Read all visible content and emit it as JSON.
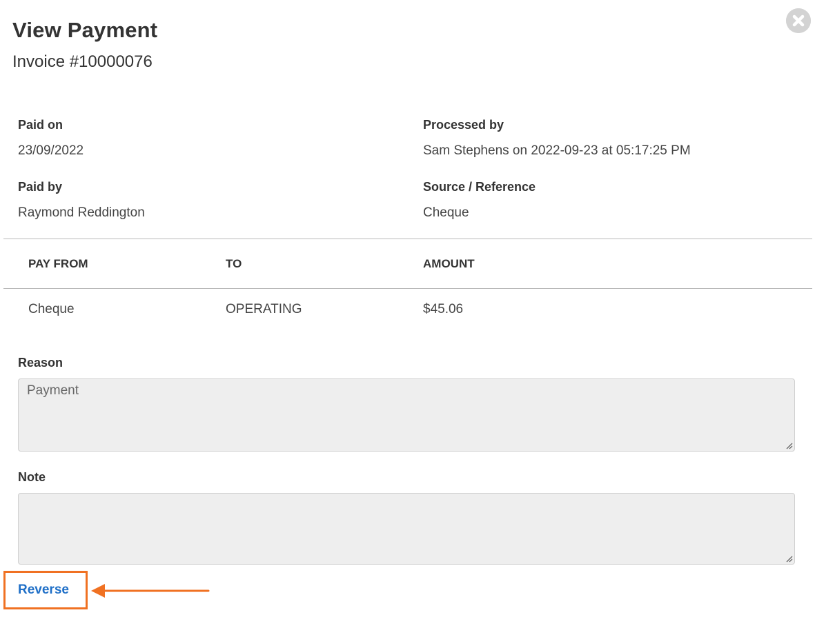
{
  "header": {
    "title": "View Payment",
    "subtitle": "Invoice #10000076",
    "close_icon": "close-circle-icon"
  },
  "details": {
    "paid_on": {
      "label": "Paid on",
      "value": "23/09/2022"
    },
    "processed_by": {
      "label": "Processed by",
      "value": "Sam Stephens on 2022-09-23 at 05:17:25 PM"
    },
    "paid_by": {
      "label": "Paid by",
      "value": "Raymond Reddington"
    },
    "source": {
      "label": "Source / Reference",
      "value": "Cheque"
    }
  },
  "table": {
    "columns": [
      "PAY FROM",
      "TO",
      "AMOUNT"
    ],
    "rows": [
      [
        "Cheque",
        "OPERATING",
        "$45.06"
      ]
    ]
  },
  "reason": {
    "label": "Reason",
    "value": "Payment"
  },
  "note": {
    "label": "Note",
    "value": ""
  },
  "actions": {
    "reverse_label": "Reverse"
  },
  "colors": {
    "highlight": "#f07122",
    "link": "#1f6fc7",
    "field_bg": "#eeeeee"
  }
}
